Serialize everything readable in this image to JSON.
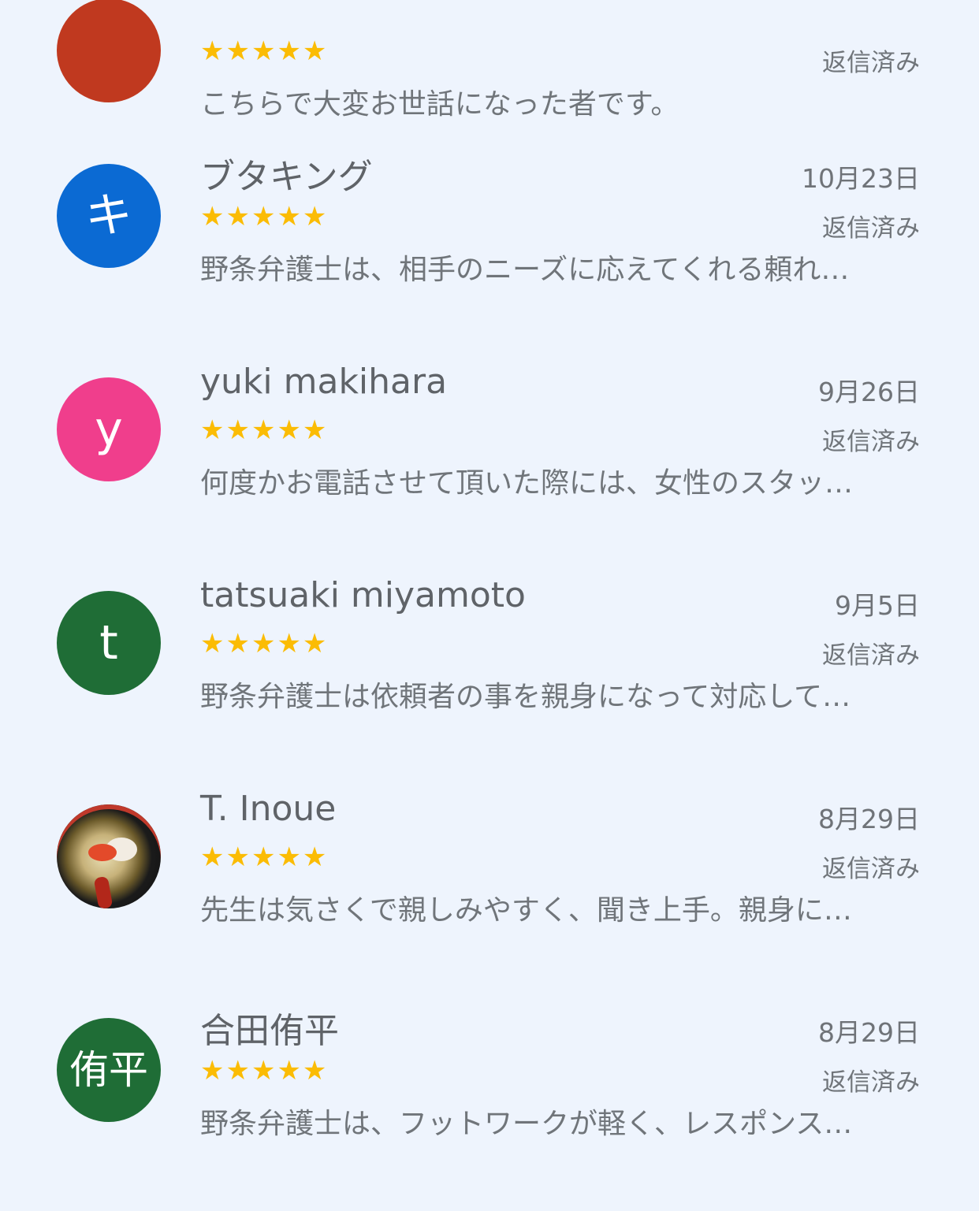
{
  "reviews": [
    {
      "name": "",
      "date": "",
      "initial": "",
      "avatar_color": "#c0391f",
      "rating": "★★★★★",
      "reply_status": "返信済み",
      "snippet": "こちらで大変お世話になった者です。"
    },
    {
      "name": "ブタキング",
      "date": "10月23日",
      "initial": "キ",
      "avatar_color": "#0b6ad3",
      "rating": "★★★★★",
      "reply_status": "返信済み",
      "snippet": "野条弁護士は、相手のニーズに応えてくれる頼れ…"
    },
    {
      "name": "yuki makihara",
      "date": "9月26日",
      "initial": "y",
      "avatar_color": "#f03e8c",
      "rating": "★★★★★",
      "reply_status": "返信済み",
      "snippet": "何度かお電話させて頂いた際には、女性のスタッ…"
    },
    {
      "name": "tatsuaki miyamoto",
      "date": "9月5日",
      "initial": "t",
      "avatar_color": "#1f6d36",
      "rating": "★★★★★",
      "reply_status": "返信済み",
      "snippet": "野条弁護士は依頼者の事を親身になって対応して…"
    },
    {
      "name": "T. Inoue",
      "date": "8月29日",
      "initial": "",
      "avatar_color": "",
      "rating": "★★★★★",
      "reply_status": "返信済み",
      "snippet": "先生は気さくで親しみやすく、聞き上手。親身に…"
    },
    {
      "name": "合田侑平",
      "date": "8月29日",
      "initial": "侑平",
      "avatar_color": "#1f6d36",
      "rating": "★★★★★",
      "reply_status": "返信済み",
      "snippet": "野条弁護士は、フットワークが軽く、レスポンス…"
    }
  ]
}
